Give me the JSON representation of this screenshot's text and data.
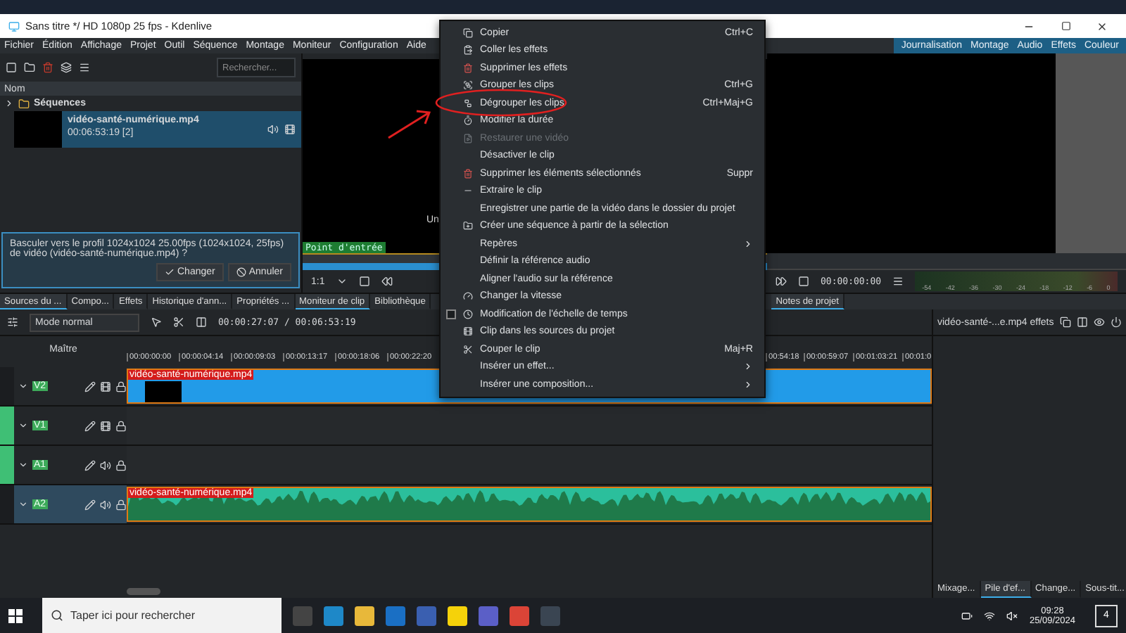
{
  "window": {
    "title": "Sans titre */ HD 1080p 25 fps - Kdenlive"
  },
  "menu_bar": [
    "Fichier",
    "Édition",
    "Affichage",
    "Projet",
    "Outil",
    "Séquence",
    "Montage",
    "Moniteur",
    "Configuration",
    "Aide"
  ],
  "workspaces": [
    "Journalisation",
    "Montage",
    "Audio",
    "Effets",
    "Couleur"
  ],
  "bin": {
    "search_placeholder": "Rechercher...",
    "column": "Nom",
    "folder": "Séquences",
    "clip_name": "vidéo-santé-numérique.mp4",
    "clip_duration": "00:06:53:19 [2]"
  },
  "profile_prompt": {
    "message": "Basculer vers le profil 1024x1024 25.00fps (1024x1024, 25fps) de vidéo (vidéo-santé-numérique.mp4) ?",
    "buttons": [
      "Changer",
      "Annuler"
    ]
  },
  "left_tabs": [
    {
      "label": "Sources du ...",
      "selected": true
    },
    {
      "label": "Compo...",
      "selected": false
    },
    {
      "label": "Effets",
      "selected": false
    },
    {
      "label": "Historique d'ann...",
      "selected": false
    },
    {
      "label": "Propriétés ...",
      "selected": false
    }
  ],
  "monitor_tabs": [
    {
      "label": "Moniteur de clip",
      "selected": true
    },
    {
      "label": "Bibliothèque",
      "selected": false
    }
  ],
  "clip_monitor": {
    "overlay_text": "Un",
    "in_point": "Point d'entrée",
    "zoom": "1:1"
  },
  "project_monitor": {
    "timecode": "00:00:00:00",
    "meter_ticks": [
      "-54",
      "-42",
      "-36",
      "-30",
      "-24",
      "-18",
      "-12",
      "-6",
      "0"
    ],
    "tab": "Notes de projet"
  },
  "timeline": {
    "mode": "Mode normal",
    "position": "00:00:27:07 / 00:06:53:19",
    "master": "Maître",
    "ruler_left": [
      "00:00:00:00",
      "00:00:04:14",
      "00:00:09:03",
      "00:00:13:17",
      "00:00:18:06",
      "00:00:22:20"
    ],
    "ruler_right": [
      "00:54:18",
      "00:00:59:07",
      "00:01:03:21",
      "00:01:0"
    ],
    "tracks": [
      {
        "name": "V2",
        "kind": "video",
        "clip": "vidéo-santé-numérique.mp4",
        "selected": false,
        "active": false
      },
      {
        "name": "V1",
        "kind": "video",
        "selected": false,
        "active": true
      },
      {
        "name": "A1",
        "kind": "audio",
        "selected": false,
        "active": true
      },
      {
        "name": "A2",
        "kind": "audio",
        "clip": "vidéo-santé-numérique.mp4",
        "selected": true,
        "active": false
      }
    ]
  },
  "effects_panel": {
    "title": "vidéo-santé-...e.mp4 effets",
    "tabs": [
      {
        "label": "Mixage...",
        "selected": false
      },
      {
        "label": "Pile d'ef...",
        "selected": true
      },
      {
        "label": "Change...",
        "selected": false
      },
      {
        "label": "Sous-tit...",
        "selected": false
      }
    ]
  },
  "context_menu": {
    "items": [
      {
        "label": "Copier",
        "shortcut": "Ctrl+C",
        "kind": "action",
        "disabled": false,
        "submenu": false
      },
      {
        "label": "Coller les effets",
        "kind": "action",
        "disabled": false,
        "submenu": false
      },
      {
        "label": "Supprimer les effets",
        "kind": "action",
        "disabled": false,
        "submenu": false
      },
      {
        "label": "Grouper les clips",
        "shortcut": "Ctrl+G",
        "kind": "action",
        "disabled": false,
        "submenu": false
      },
      {
        "label": "Dégrouper les clips",
        "shortcut": "Ctrl+Maj+G",
        "kind": "action",
        "disabled": false,
        "submenu": false
      },
      {
        "label": "Modifier la durée",
        "kind": "action",
        "disabled": false,
        "submenu": false
      },
      {
        "label": "Restaurer une vidéo",
        "kind": "action",
        "disabled": true,
        "submenu": false
      },
      {
        "label": "Désactiver le clip",
        "kind": "action",
        "disabled": false,
        "submenu": false
      },
      {
        "label": "Supprimer les éléments sélectionnés",
        "shortcut": "Suppr",
        "kind": "action",
        "disabled": false,
        "submenu": false
      },
      {
        "label": "Extraire le clip",
        "kind": "action",
        "disabled": false,
        "submenu": false
      },
      {
        "label": "Enregistrer une partie de la vidéo dans le dossier du projet",
        "kind": "action",
        "disabled": false,
        "submenu": false
      },
      {
        "label": "Créer une séquence à partir de la sélection",
        "kind": "action",
        "disabled": false,
        "submenu": false
      },
      {
        "label": "Repères",
        "kind": "action",
        "disabled": false,
        "submenu": true
      },
      {
        "label": "Définir la référence audio",
        "kind": "action",
        "disabled": false,
        "submenu": false
      },
      {
        "label": "Aligner l'audio sur la référence",
        "kind": "action",
        "disabled": false,
        "submenu": false
      },
      {
        "label": "Changer la vitesse",
        "kind": "action",
        "disabled": false,
        "submenu": false
      },
      {
        "label": "Modification de l'échelle de temps",
        "kind": "checkbox",
        "checked": false,
        "disabled": false,
        "submenu": false
      },
      {
        "label": "Clip dans les sources du projet",
        "kind": "action",
        "disabled": false,
        "submenu": false
      },
      {
        "label": "Couper le clip",
        "shortcut": "Maj+R",
        "kind": "action",
        "disabled": false,
        "submenu": false
      },
      {
        "label": "Insérer un effet...",
        "kind": "action",
        "disabled": false,
        "submenu": true
      },
      {
        "label": "Insérer une composition...",
        "kind": "action",
        "disabled": false,
        "submenu": true
      }
    ]
  },
  "taskbar": {
    "search_placeholder": "Taper ici pour rechercher",
    "time": "09:28",
    "date": "25/09/2024",
    "notifications": "4"
  }
}
